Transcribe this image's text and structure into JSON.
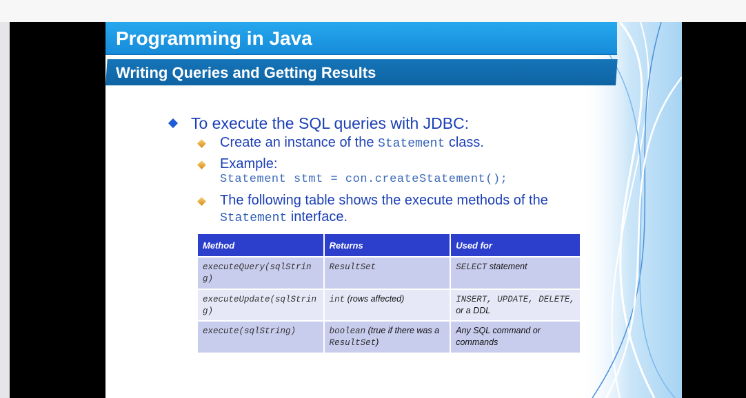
{
  "slide": {
    "title": "Programming in Java",
    "subtitle": "Writing Queries and Getting Results",
    "bullet_main": "To execute the SQL queries with JDBC:",
    "sub1": {
      "prefix": "Create an instance of the ",
      "code": "Statement",
      "suffix": " class."
    },
    "sub2": {
      "label": "Example:",
      "code": "Statement stmt = con.createStatement();"
    },
    "sub3": {
      "line1": "The following table shows the execute methods of the",
      "code": "Statement",
      "suffix": " interface."
    }
  },
  "table": {
    "headers": [
      "Method",
      "Returns",
      "Used for"
    ],
    "rows": [
      {
        "method": "executeQuery(sqlString)",
        "returns_code": "ResultSet",
        "returns_text": "",
        "returns_code2": "",
        "returns_text2": "",
        "used_code": "SELECT",
        "used_text": " statement"
      },
      {
        "method": "executeUpdate(sqlString)",
        "returns_code": "int",
        "returns_text": " (rows affected)",
        "returns_code2": "",
        "returns_text2": "",
        "used_code": "INSERT, UPDATE, DELETE,",
        "used_text": " or a DDL"
      },
      {
        "method": "execute(sqlString)",
        "returns_code": "boolean",
        "returns_text": " (true if there was a ",
        "returns_code2": "ResultSet",
        "returns_text2": ")",
        "used_code": "",
        "used_text": "Any SQL command or commands"
      }
    ]
  },
  "colors": {
    "title_band": "#1a95e0",
    "subtitle_band": "#1268aa",
    "text_blue": "#1b3fb5",
    "table_header": "#2b3fcc"
  }
}
